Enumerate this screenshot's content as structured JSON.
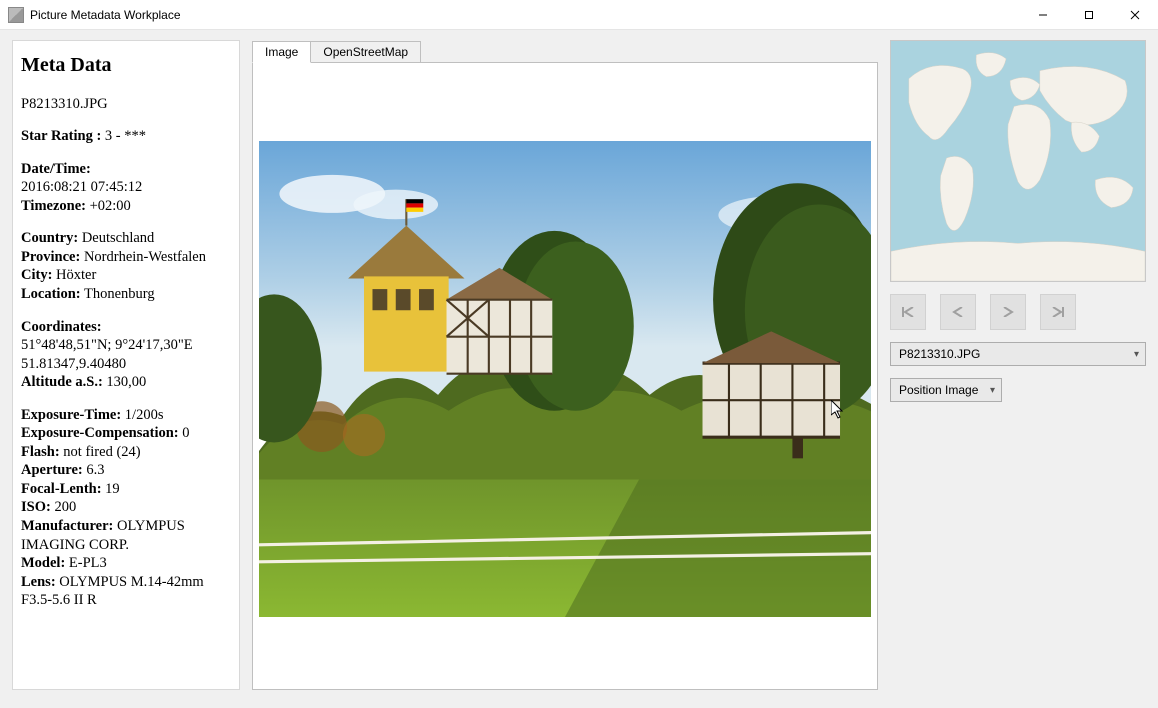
{
  "window": {
    "title": "Picture Metadata Workplace"
  },
  "meta": {
    "heading": "Meta Data",
    "filename": "P8213310.JPG",
    "star_rating_label": "Star Rating :",
    "star_rating_value": "3 - ***",
    "datetime_label": "Date/Time:",
    "datetime_value": "2016:08:21 07:45:12",
    "timezone_label": "Timezone:",
    "timezone_value": "+02:00",
    "country_label": "Country:",
    "country_value": "Deutschland",
    "province_label": "Province:",
    "province_value": "Nordrhein-Westfalen",
    "city_label": "City:",
    "city_value": "Höxter",
    "location_label": "Location:",
    "location_value": "Thonenburg",
    "coords_label": "Coordinates:",
    "coords_dms": "51°48'48,51\"N; 9°24'17,30\"E",
    "coords_dec": "51.81347,9.40480",
    "altitude_label": "Altitude a.S.:",
    "altitude_value": "130,00",
    "exposure_label": "Exposure-Time:",
    "exposure_value": "1/200s",
    "expcomp_label": "Exposure-Compensation:",
    "expcomp_value": "0",
    "flash_label": "Flash:",
    "flash_value": "not fired (24)",
    "aperture_label": "Aperture:",
    "aperture_value": "6.3",
    "focal_label": "Focal-Lenth:",
    "focal_value": "19",
    "iso_label": "ISO:",
    "iso_value": "200",
    "manufacturer_label": "Manufacturer:",
    "manufacturer_value": "OLYMPUS IMAGING CORP.",
    "model_label": "Model:",
    "model_value": "E-PL3",
    "lens_label": "Lens:",
    "lens_value": "OLYMPUS M.14-42mm F3.5-5.6 II R"
  },
  "tabs": {
    "image": "Image",
    "osm": "OpenStreetMap"
  },
  "right": {
    "file_selector": "P8213310.JPG",
    "action_selector": "Position Image"
  }
}
